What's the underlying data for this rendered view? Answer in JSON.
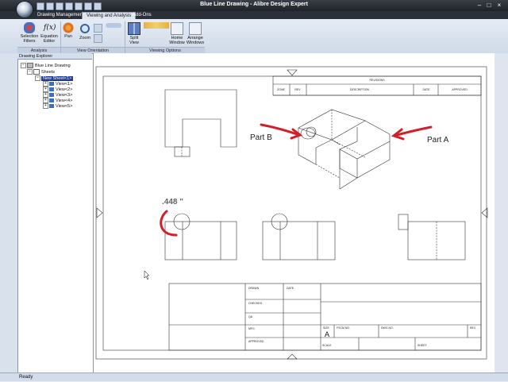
{
  "window": {
    "title": "Blue Line Drawing - Alibre Design Expert"
  },
  "tabs": [
    "Drawing Management",
    "Viewing and Analysis",
    "Add-Ons"
  ],
  "ribbon": {
    "buttons": {
      "selection_filters": "Selection Filters",
      "equation_editor": "Equation Editor",
      "fx": "f(x)",
      "pan": "Pan",
      "zoom": "Zoom",
      "split_view": "Split View",
      "home_window": "Home Window",
      "arrange_windows": "Arrange Windows"
    },
    "groups": [
      "Analysis",
      "View Orientation",
      "Viewing Options"
    ]
  },
  "explorer": {
    "title": "Drawing Explorer",
    "root": "Blue Line Drawing",
    "sheets": "Sheets",
    "sheet": "New Sheet<1>",
    "views": [
      "View<1>",
      "View<2>",
      "View<3>",
      "View<4>",
      "View<5>"
    ]
  },
  "drawing": {
    "revisions_header": "REVISIONS",
    "rev_columns": [
      "ZONE",
      "REV",
      "DESCRIPTION",
      "DATE",
      "APPROVED"
    ],
    "callouts": {
      "part_a": "Part A",
      "part_b": "Part B",
      "dimension": ".448 \""
    },
    "title_block": {
      "drawn": "DRAWN",
      "date": "DATE",
      "checked": "CHECKED",
      "qa": "QA",
      "mfg": "MFG",
      "approved": "APPROVED",
      "size": "SIZE",
      "size_value": "A",
      "fscm_no": "FSCM NO.",
      "dwg_no": "DWG NO.",
      "rev": "REV",
      "scale": "SCALE",
      "sheet": "SHEET"
    },
    "colors": {
      "callout_red": "#d0202a"
    }
  },
  "status": {
    "text": "Ready"
  }
}
